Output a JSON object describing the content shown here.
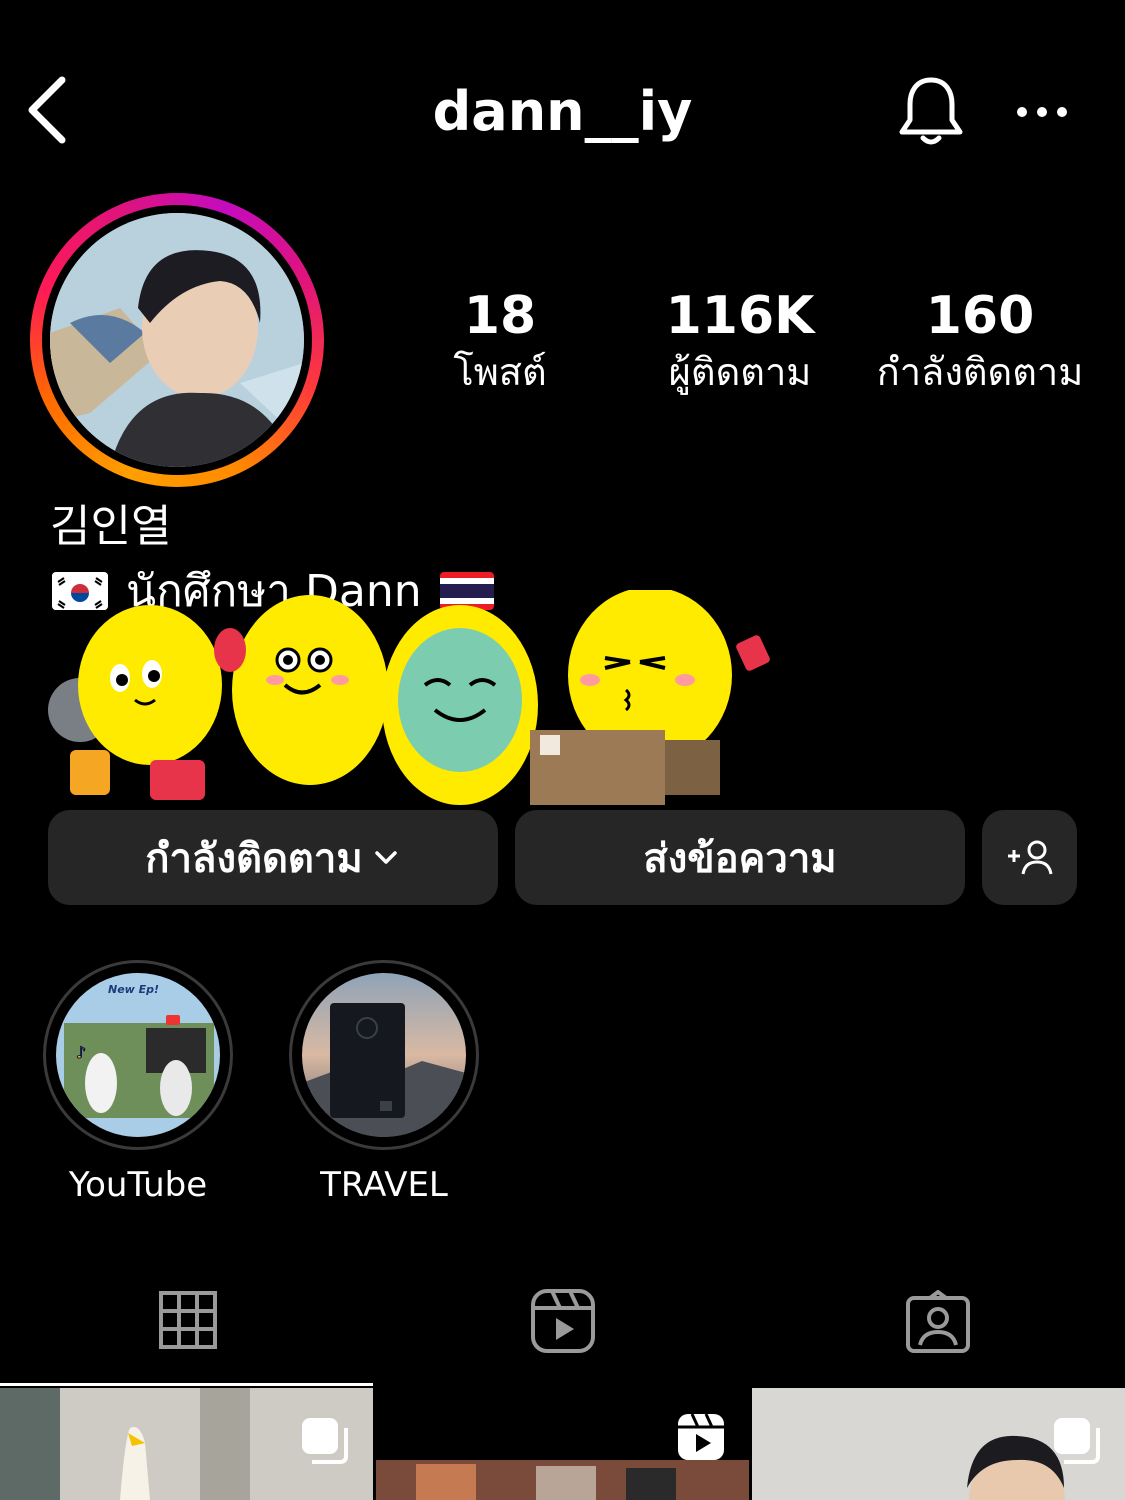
{
  "header": {
    "username": "dann__iy",
    "back_icon": "chevron-left-icon",
    "bell_icon": "bell-icon",
    "more_icon": "more-horizontal-icon"
  },
  "stats": [
    {
      "value": "18",
      "label": "โพสต์"
    },
    {
      "value": "116K",
      "label": "ผู้ติดตาม"
    },
    {
      "value": "160",
      "label": "กำลังติดตาม"
    }
  ],
  "profile": {
    "display_name": "김인열",
    "bio": "นักศึกษา Dann"
  },
  "actions": {
    "following_label": "กำลังติดตาม",
    "message_label": "ส่งข้อความ"
  },
  "highlights": [
    {
      "label": "YouTube",
      "text": "New Ep!"
    },
    {
      "label": "TRAVEL"
    }
  ],
  "tabs": [
    "grid-icon",
    "reels-icon",
    "tagged-icon"
  ],
  "colors": {
    "background": "#000000",
    "button": "#262626",
    "text": "#ffffff",
    "ring_orange": "#ff9f00",
    "ring_pink": "#e0147a"
  }
}
